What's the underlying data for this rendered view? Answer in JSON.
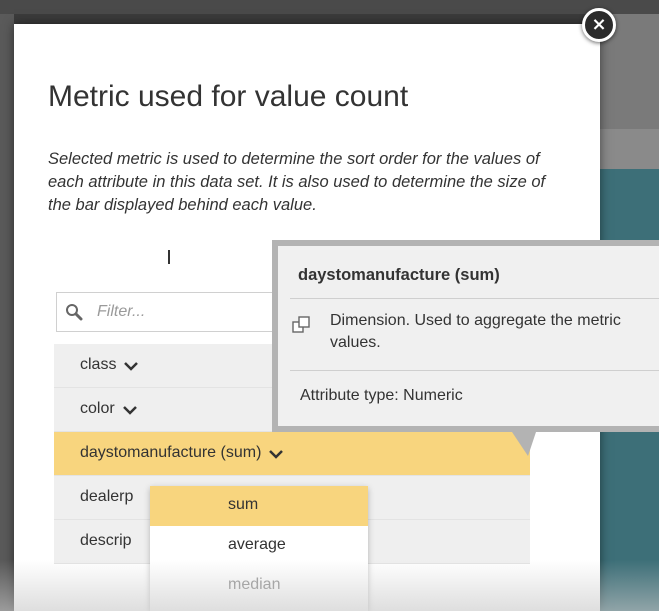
{
  "dialog": {
    "title": "Metric used for value count",
    "description": "Selected metric is used to determine the sort order for the values of each attribute in this data set. It is also used to determine the size of the bar displayed behind each value.",
    "close_icon": "close-icon"
  },
  "filter": {
    "placeholder": "Filter...",
    "value": ""
  },
  "attributes": [
    {
      "label": "class"
    },
    {
      "label": "color"
    },
    {
      "label": "daystomanufacture (sum)"
    },
    {
      "label": "dealerp"
    },
    {
      "label": "descrip"
    }
  ],
  "metric_dropdown": {
    "options": [
      "sum",
      "average",
      "median"
    ],
    "selected": "sum"
  },
  "tooltip": {
    "title": "daystomanufacture (sum)",
    "description": "Dimension. Used to aggregate the metric values.",
    "type_text": "Attribute type: Numeric",
    "icon": "dimension-icon"
  },
  "colors": {
    "selected_row": "#f8d57e",
    "teal_background": "#3d6f78"
  }
}
